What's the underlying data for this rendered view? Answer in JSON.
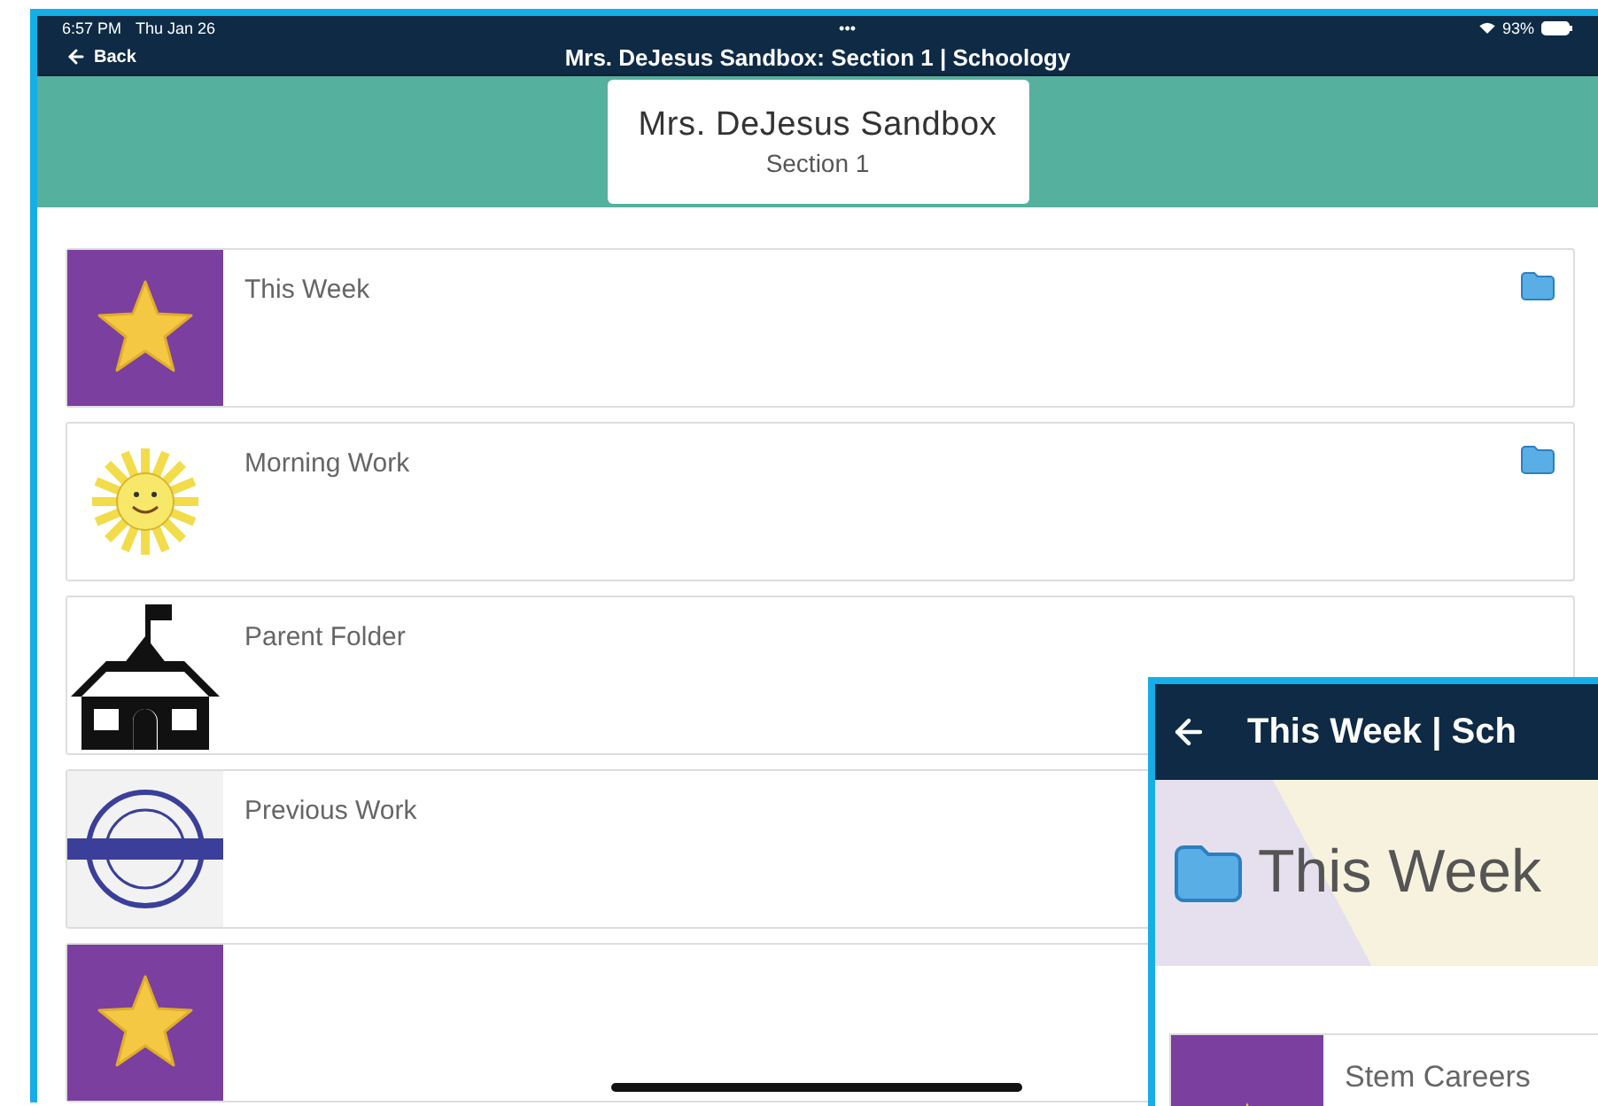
{
  "status_bar": {
    "time": "6:57 PM",
    "date": "Thu Jan 26",
    "dots": "•••",
    "battery": "93%"
  },
  "nav": {
    "back": "Back",
    "title": "Mrs. DeJesus Sandbox: Section 1 | Schoology"
  },
  "course": {
    "name": "Mrs. DeJesus Sandbox",
    "section": "Section 1"
  },
  "items": [
    {
      "title": "This Week",
      "kind": "star",
      "folder_icon": true
    },
    {
      "title": "Morning Work",
      "kind": "sun",
      "folder_icon": true
    },
    {
      "title": "Parent Folder",
      "kind": "school",
      "folder_icon": false
    },
    {
      "title": "Previous Work",
      "kind": "badge",
      "folder_icon": false
    },
    {
      "kind": "star",
      "folder_icon": false
    }
  ],
  "overlay": {
    "title": "This Week | Sch",
    "folder": "This Week",
    "items": [
      {
        "title": "Stem Careers",
        "kind": "star"
      }
    ]
  }
}
